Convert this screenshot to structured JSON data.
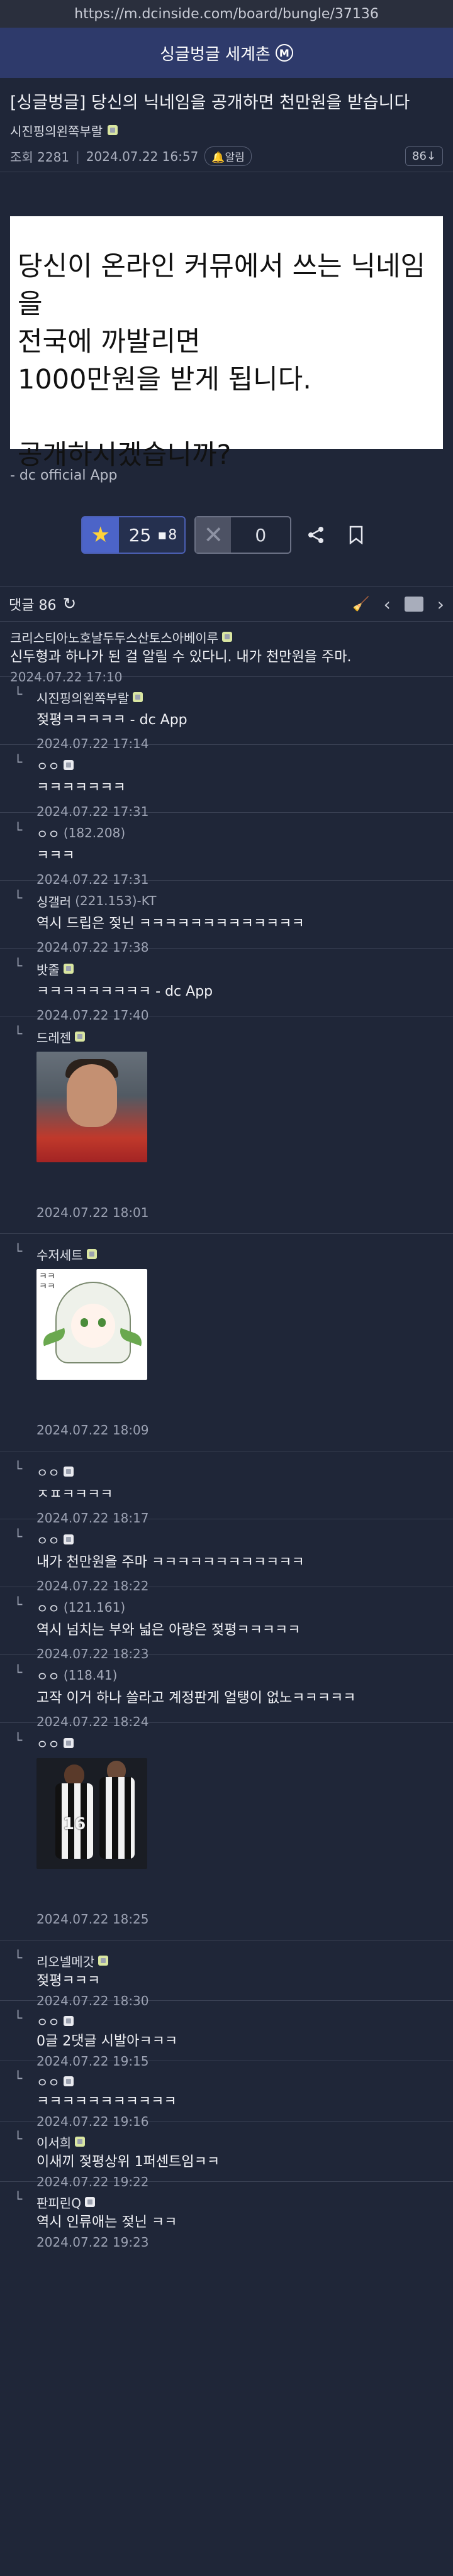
{
  "browser": {
    "url": "https://m.dcinside.com/board/bungle/37136"
  },
  "gallery": {
    "title": "싱글벙글 세계촌",
    "minor_mark": "M"
  },
  "post": {
    "title": "[싱글벙글] 당신의 닉네임을 공개하면 천만원을 받습니다",
    "author": "시진핑의왼쪽부랄",
    "views_label": "조회 2281",
    "date": "2024.07.22 16:57",
    "alarm_label": "알림",
    "view_count": "86",
    "body_lines": [
      "당신이 온라인 커뮤에서 쓰는 닉네임을",
      "전국에 까발리면",
      "1000만원을 받게 됩니다.",
      "",
      "공개하시겠습니까?"
    ],
    "signature": "- dc official App",
    "recommend": "25",
    "fixed_recommend": "8",
    "nonrecommend": "0"
  },
  "comment_bar": {
    "label": "댓글 86"
  },
  "comments": [
    {
      "nick": "크리스티아노호날두두스산토스아베이루",
      "ip": "",
      "text": "신두형과 하나가 된 걸 알릴 수 있다니. 내가 천만원을 주마.",
      "time": "2024.07.22 17:10"
    },
    {
      "nick": "시진핑의왼쪽부랄",
      "ip": "",
      "text": "젖평ㅋㅋㅋㅋㅋ - dc App",
      "time": "2024.07.22 17:14"
    },
    {
      "nick": "ㅇㅇ",
      "ip": "",
      "text": "ㅋㅋㅋㅋㅋㅋㅋ",
      "time": "2024.07.22 17:31"
    },
    {
      "nick": "ㅇㅇ",
      "ip": "(182.208)",
      "text": "ㅋㅋㅋ",
      "time": "2024.07.22 17:31"
    },
    {
      "nick": "싱갤러",
      "ip": "(221.153)-KT",
      "text": "역시 드립은 젖닌 ㅋㅋㅋㅋㅋㅋㅋㅋㅋㅋㅋㅋㅋ",
      "time": "2024.07.22 17:38"
    },
    {
      "nick": "밧줄",
      "ip": "",
      "text": "ㅋㅋㅋㅋㅋㅋㅋㅋㅋ - dc App",
      "time": "2024.07.22 17:40"
    },
    {
      "nick": "드레젠",
      "ip": "",
      "text": "",
      "time": "2024.07.22 18:01"
    },
    {
      "nick": "수저세트",
      "ip": "",
      "text": "",
      "time": "2024.07.22 18:09",
      "image_text": "ㅋㅋ\nㅋㅋ"
    },
    {
      "nick": "ㅇㅇ",
      "ip": "",
      "text": "ㅈㅍㅋㅋㅋㅋ",
      "time": "2024.07.22 18:17"
    },
    {
      "nick": "ㅇㅇ",
      "ip": "",
      "text": "내가 천만원을 주마 ㅋㅋㅋㅋㅋㅋㅋㅋㅋㅋㅋㅋ",
      "time": "2024.07.22 18:22"
    },
    {
      "nick": "ㅇㅇ",
      "ip": "(121.161)",
      "text": "역시 넘치는 부와 넓은 아량은 젖평ㅋㅋㅋㅋㅋ",
      "time": "2024.07.22 18:23"
    },
    {
      "nick": "ㅇㅇ",
      "ip": "(118.41)",
      "text": "고작 이거 하나 쓸라고 계정판게 얼탱이 없노ㅋㅋㅋㅋㅋ",
      "time": "2024.07.22 18:24"
    },
    {
      "nick": "ㅇㅇ",
      "ip": "",
      "text": "",
      "time": "2024.07.22 18:25",
      "image_text": "16"
    },
    {
      "nick": "리오넬메갓",
      "ip": "",
      "text": "젖평ㅋㅋㅋ",
      "time": "2024.07.22 18:30"
    },
    {
      "nick": "ㅇㅇ",
      "ip": "",
      "text": "0글 2댓글 시발아ㅋㅋㅋ",
      "time": "2024.07.22 19:15"
    },
    {
      "nick": "ㅇㅇ",
      "ip": "",
      "text": "ㅋㅋㅋㅋㅋㅋㅋㅋㅋㅋㅋ",
      "time": "2024.07.22 19:16"
    },
    {
      "nick": "이서희",
      "ip": "",
      "text": "이새끼 젖평상위 1퍼센트임ㅋㅋ",
      "time": "2024.07.22 19:22"
    },
    {
      "nick": "판피린Q",
      "ip": "",
      "text": "역시 인류애는 젖닌 ㅋㅋ",
      "time": "2024.07.22 19:23"
    }
  ],
  "icons": {
    "star": "★",
    "refresh": "↻",
    "share": "share-icon",
    "bookmark": "bookmark-icon",
    "prev": "‹",
    "next": "›",
    "down_arrow": "↓"
  },
  "colors": {
    "bg": "#1f2638",
    "header": "#2e3a6b",
    "accent": "#4c64c8"
  }
}
